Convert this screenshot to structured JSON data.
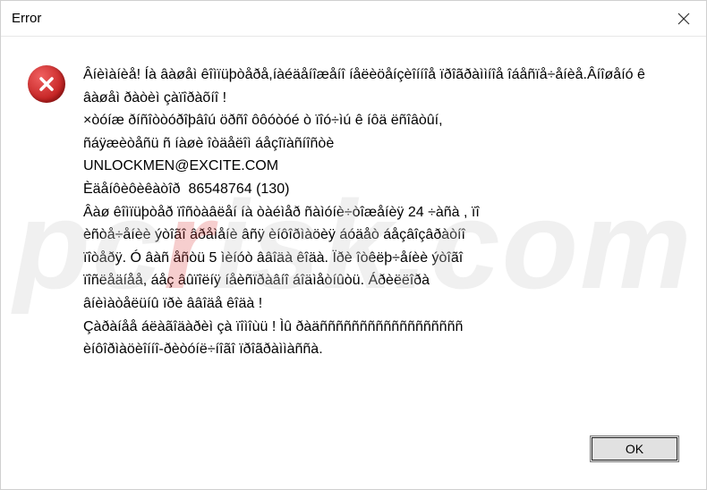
{
  "dialog": {
    "title": "Error",
    "message": "Âíèìàíèå! Íà âàøåì êîìïüþòåðå,íàéäåíîæåíî íåëèöåíçèîííîå ïðîãðàììíîå îáåñïå÷åíèå.Âíîøåíó ê âàøåì ðàòèì çàïîðàõíî !\n×òóíæ ðíñîòòóðîþâîú öðñî ôôóòóé ò ïîó÷ìú ê íôä ëñîâòûí,\nñáÿæèòåñü ñ íàøè îòäåëîì áåçîïàñíîñòè\nUNLOCKMEN@EXCITE.COM\nÈäåíôèôèêàòîð  86548764 (130)\nÂàø êîìïüþòåð ïîñòàâëåí íà òàéìåð ñàìóíè÷òîæåíèÿ 24 ÷àñà , ïî\nèñòå÷åíèè ýòîãî âðåìåíè âñÿ èíôîðìàöèÿ áóäåò áåçâîçâðàòíî\nïîòåðÿ. Ó âàñ åñòü 5 ìèíóò ââîäà êîäà. Ïðè îòêëþ÷åíèè ýòîãî\nïîñëåäíåå, áåç âûïîëíÿ íåèñïðàâíî áîäìåòíûòü. Áðèëëîðà\nâíèìàòåëüíû ïðè ââîäå êîäà !\nÇàðàíåå áëàãîäàðèì çà ïîìîùü ! Ìû ðàäññññññññññññññññññ\nèíôîðìàöèîííî-ðèòóíë÷íîãî ïðîãðàììàññà.",
    "ok_label": "OK"
  },
  "watermark": {
    "prefix": "pc",
    "r": "r",
    "suffix": "isk.com"
  }
}
